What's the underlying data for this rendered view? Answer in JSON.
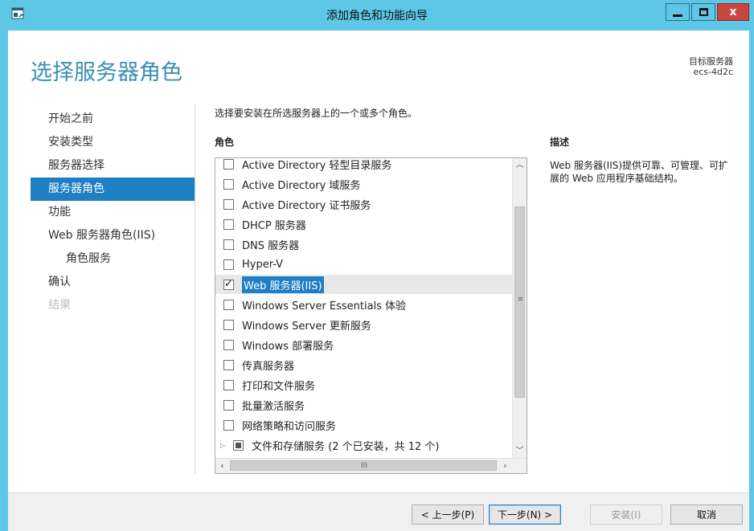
{
  "window": {
    "title": "添加角色和功能向导",
    "close_glyph": "x"
  },
  "page": {
    "title": "选择服务器角色",
    "target_label": "目标服务器",
    "target_value": "ecs-4d2c"
  },
  "nav": {
    "items": [
      {
        "label": "开始之前",
        "state": "normal"
      },
      {
        "label": "安装类型",
        "state": "normal"
      },
      {
        "label": "服务器选择",
        "state": "normal"
      },
      {
        "label": "服务器角色",
        "state": "active"
      },
      {
        "label": "功能",
        "state": "normal"
      },
      {
        "label": "Web 服务器角色(IIS)",
        "state": "normal"
      },
      {
        "label": "角色服务",
        "state": "sub"
      },
      {
        "label": "确认",
        "state": "normal"
      },
      {
        "label": "结果",
        "state": "disabled"
      }
    ]
  },
  "main": {
    "instruction": "选择要安装在所选服务器上的一个或多个角色。",
    "roles_header": "角色",
    "description_header": "描述",
    "description_text": "Web 服务器(IIS)提供可靠、可管理、可扩展的 Web 应用程序基础结构。",
    "roles": [
      {
        "label": "Active Directory 轻型目录服务",
        "checked": false
      },
      {
        "label": "Active Directory 域服务",
        "checked": false
      },
      {
        "label": "Active Directory 证书服务",
        "checked": false
      },
      {
        "label": "DHCP 服务器",
        "checked": false
      },
      {
        "label": "DNS 服务器",
        "checked": false
      },
      {
        "label": "Hyper-V",
        "checked": false
      },
      {
        "label": "Web 服务器(IIS)",
        "checked": true,
        "selected": true
      },
      {
        "label": "Windows Server Essentials 体验",
        "checked": false
      },
      {
        "label": "Windows Server 更新服务",
        "checked": false
      },
      {
        "label": "Windows 部署服务",
        "checked": false
      },
      {
        "label": "传真服务器",
        "checked": false
      },
      {
        "label": "打印和文件服务",
        "checked": false
      },
      {
        "label": "批量激活服务",
        "checked": false
      },
      {
        "label": "网络策略和访问服务",
        "checked": false
      },
      {
        "label": "文件和存储服务 (2 个已安装，共 12 个)",
        "checked": "partial",
        "expandable": true
      }
    ]
  },
  "footer": {
    "prev_label": "< 上一步(P)",
    "next_label": "下一步(N) >",
    "install_label": "安装(I)",
    "cancel_label": "取消"
  },
  "colors": {
    "titlebar": "#5ec7e6",
    "accent": "#1e7fc4",
    "page_title": "#3a8fb6"
  }
}
